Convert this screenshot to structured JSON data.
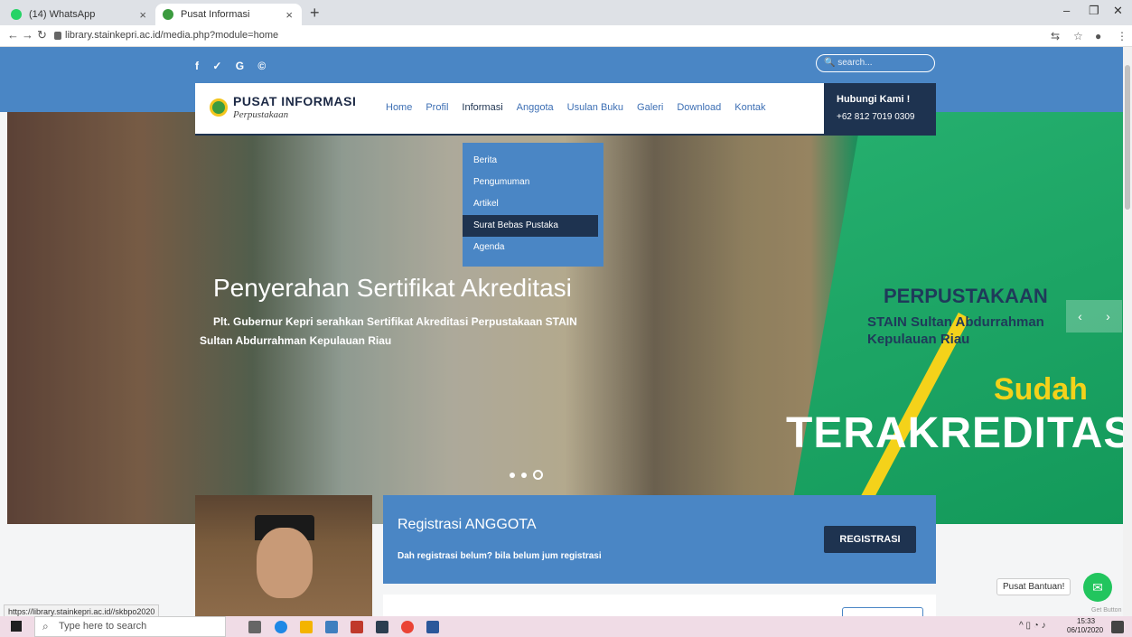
{
  "browser": {
    "tabs": [
      {
        "title": "(14) WhatsApp",
        "favicon_color": "#25d366"
      },
      {
        "title": "Pusat Informasi",
        "favicon_color": "#3b9b3f"
      }
    ],
    "new_tab": "+",
    "url": "library.stainkepri.ac.id/media.php?module=home"
  },
  "topbar": {
    "social_icons": "f ✓ G ©",
    "search_placeholder": "🔍 search..."
  },
  "navbar": {
    "logo_title": "PUSAT INFORMASI",
    "logo_subtitle": "Perpustakaan",
    "items": [
      "Home",
      "Profil",
      "Informasi",
      "Anggota",
      "Usulan Buku",
      "Galeri",
      "Download",
      "Kontak"
    ],
    "contact_heading": "Hubungi Kami !",
    "contact_phone": "+62 812 7019 0309"
  },
  "dropdown": {
    "items": [
      "Berita",
      "Pengumuman",
      "Artikel",
      "Surat Bebas Pustaka",
      "Agenda"
    ],
    "active_index": 3
  },
  "hero": {
    "title": "Penyerahan Sertifikat Akreditasi",
    "subtitle_line1": "Plt. Gubernur Kepri serahkan Sertifikat Akreditasi Perpustakaan STAIN",
    "subtitle_line2": "Sultan Abdurrahman Kepulauan Riau",
    "banner_line1": "PERPUSTAKAAN",
    "banner_line2": "STAIN Sultan Abdurrahman",
    "banner_line3": "Kepulauan Riau",
    "banner_sudah": "Sudah",
    "banner_terakreditasi": "TERAKREDITASI",
    "prev_arrow": "‹",
    "next_arrow": "›"
  },
  "registration": {
    "title": "Registrasi ANGGOTA",
    "subtitle": "Dah registrasi belum? bila belum jum registrasi",
    "button": "REGISTRASI"
  },
  "help": {
    "label": "Pusat Bantuan!",
    "powered": "Get Button"
  },
  "status_bar_url": "https://library.stainkepri.ac.id//skbpo2020",
  "taskbar": {
    "search_placeholder": "Type here to search",
    "time": "15:33",
    "date": "06/10/2020"
  }
}
